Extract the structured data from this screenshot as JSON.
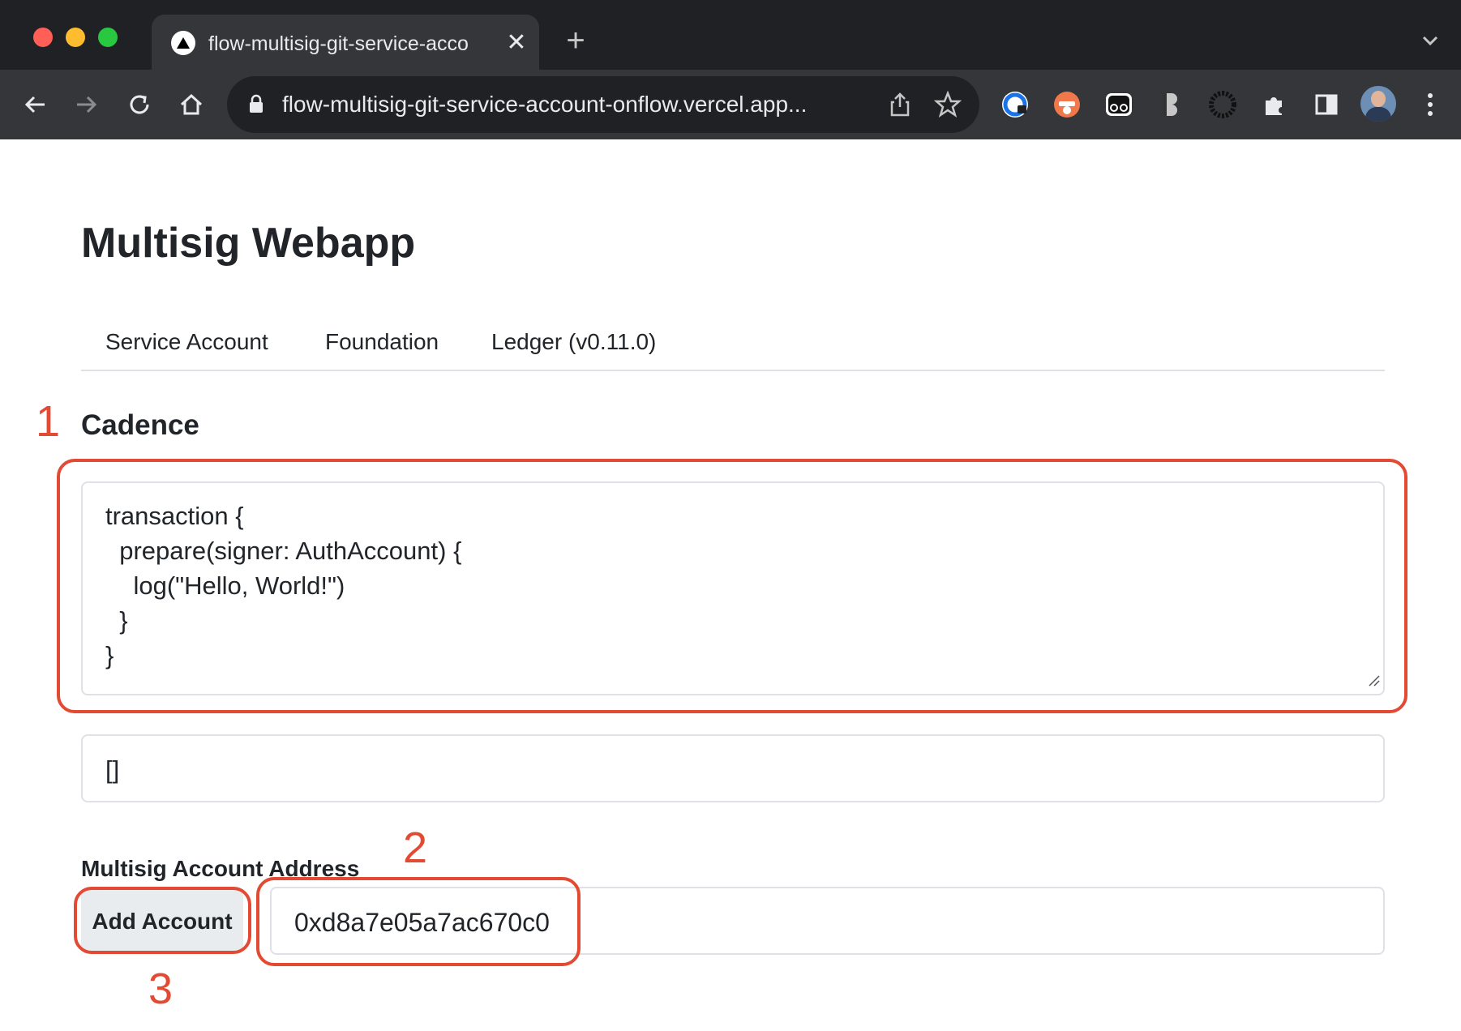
{
  "browser": {
    "tab_title": "flow-multisig-git-service-acco",
    "tab_close": "✕",
    "new_tab": "+",
    "url": "flow-multisig-git-service-account-onflow.vercel.app..."
  },
  "page": {
    "title": "Multisig Webapp",
    "tabs": [
      {
        "label": "Service Account"
      },
      {
        "label": "Foundation"
      },
      {
        "label": "Ledger (v0.11.0)"
      }
    ],
    "cadence": {
      "heading": "Cadence",
      "code_lines": [
        "transaction {",
        "  prepare(signer: AuthAccount) {",
        "    log(\"Hello, World!\")",
        "  }",
        "}"
      ]
    },
    "arguments_value": "[]",
    "multisig": {
      "label": "Multisig Account Address",
      "add_button": "Add Account",
      "address": "0xd8a7e05a7ac670c0"
    }
  },
  "annotations": {
    "marker_1": "1",
    "marker_2": "2",
    "marker_3": "3",
    "color": "#e24a33"
  }
}
